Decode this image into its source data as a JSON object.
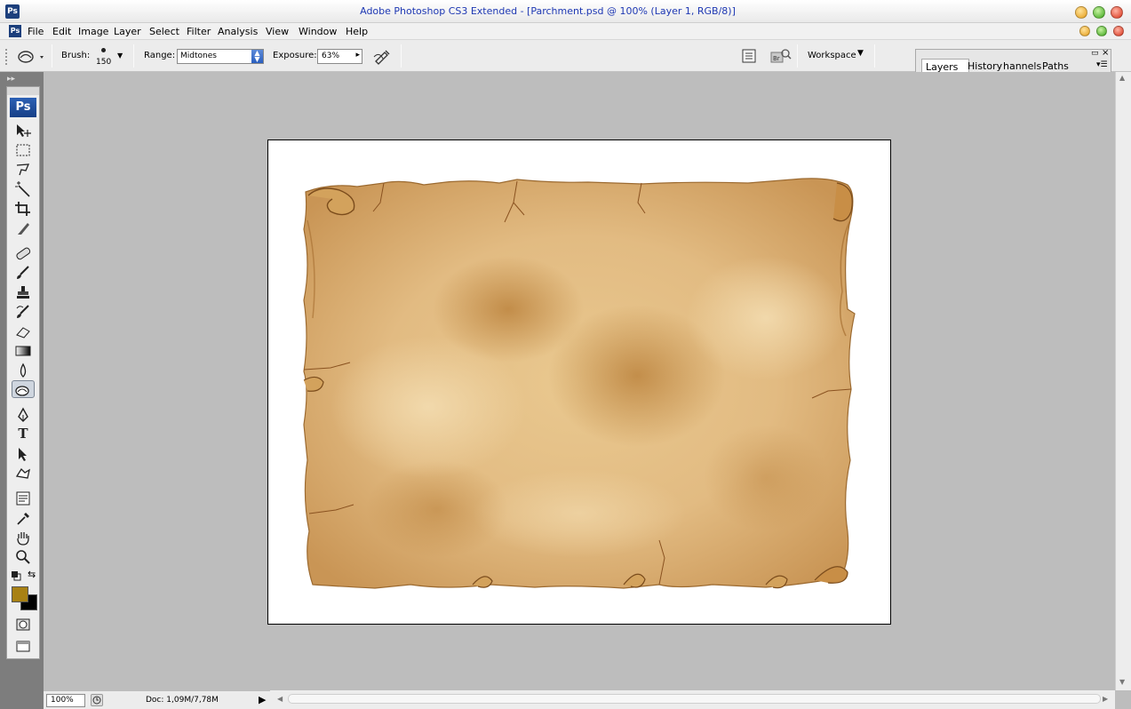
{
  "window": {
    "app_icon": "Ps",
    "title": "Adobe Photoshop CS3 Extended - [Parchment.psd @ 100% (Layer 1, RGB/8)]"
  },
  "menu": [
    "File",
    "Edit",
    "Image",
    "Layer",
    "Select",
    "Filter",
    "Analysis",
    "View",
    "Window",
    "Help"
  ],
  "options": {
    "brush_label": "Brush:",
    "brush_size": "150",
    "range_label": "Range:",
    "range_value": "Midtones",
    "exposure_label": "Exposure:",
    "exposure_value": "63%",
    "workspace_label": "Workspace",
    "bridge_icon_text": "Br"
  },
  "panels": {
    "tabs": [
      "Layers",
      "History",
      "hannels",
      "Paths"
    ]
  },
  "toolbox": {
    "logo": "Ps",
    "active_tool": "burn-tool",
    "foreground_color": "#a88114",
    "background_color": "#000000",
    "type_tool_glyph": "T"
  },
  "document": {
    "name": "Parchment.psd",
    "image_description": "parchment-scroll"
  },
  "status": {
    "zoom": "100%",
    "doc_info": "Doc: 1,09M/7,78M"
  },
  "colors": {
    "title_text": "#1e38b3",
    "canvas_bg": "#bdbdbd",
    "parchment_base": "#e6c28c",
    "parchment_dark": "#b97a35"
  }
}
